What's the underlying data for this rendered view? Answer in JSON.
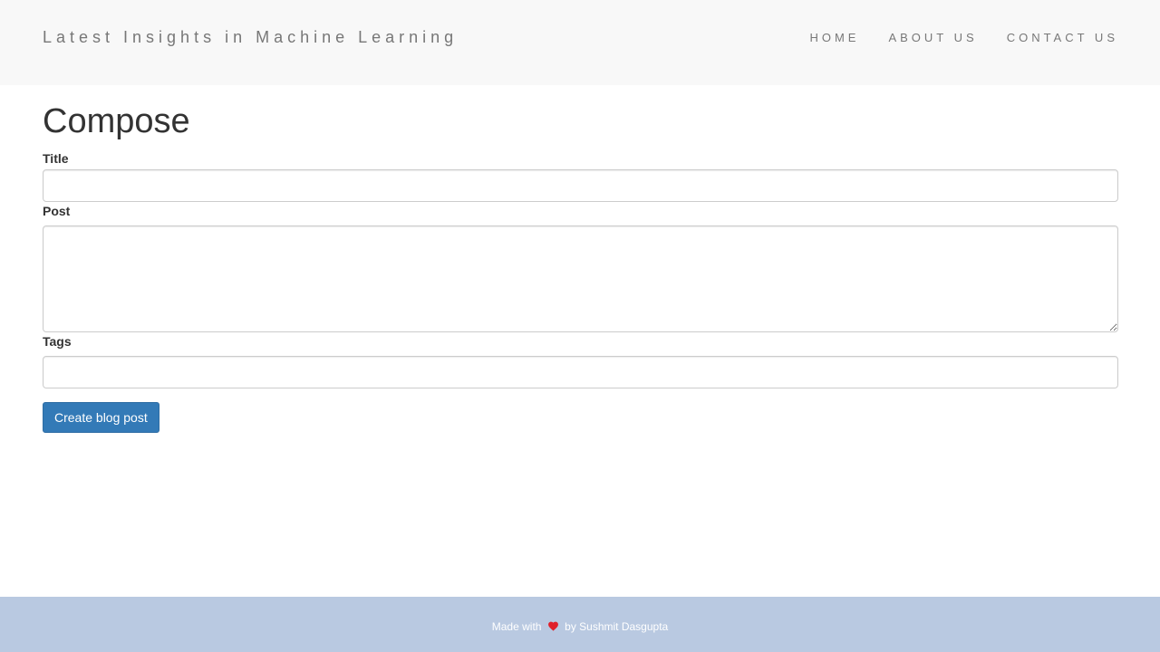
{
  "navbar": {
    "brand": "Latest Insights in Machine Learning",
    "links": [
      {
        "label": "HOME"
      },
      {
        "label": "ABOUT US"
      },
      {
        "label": "CONTACT US"
      }
    ]
  },
  "main": {
    "page_title": "Compose",
    "fields": {
      "title": {
        "label": "Title",
        "value": "",
        "placeholder": ""
      },
      "post": {
        "label": "Post",
        "value": "",
        "placeholder": ""
      },
      "tags": {
        "label": "Tags",
        "value": "",
        "placeholder": ""
      }
    },
    "submit_label": "Create blog post"
  },
  "footer": {
    "made_with": "Made with",
    "icon": "heart-icon",
    "author_text": "by Sushmit Dasgupta"
  },
  "colors": {
    "navbar_bg": "#f8f8f8",
    "primary_button": "#337ab7",
    "footer_bg": "#b9c9e1",
    "heart": "#e0202a"
  }
}
